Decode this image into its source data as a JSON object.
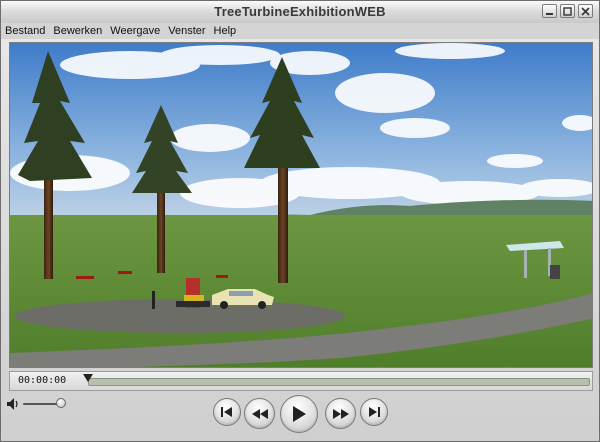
{
  "window": {
    "title": "TreeTurbineExhibitionWEB"
  },
  "menu": {
    "items": [
      "Bestand",
      "Bewerken",
      "Weergave",
      "Venster",
      "Help"
    ]
  },
  "player": {
    "timecode": "00:00:00",
    "progress": 0.0,
    "volume": 0.85
  },
  "icons": {
    "minimize": "minimize-icon",
    "maximize": "maximize-icon",
    "close": "close-icon",
    "volume": "speaker-icon",
    "controls": [
      "skip-back-icon",
      "rewind-icon",
      "play-icon",
      "fast-forward-icon",
      "skip-forward-icon"
    ]
  }
}
